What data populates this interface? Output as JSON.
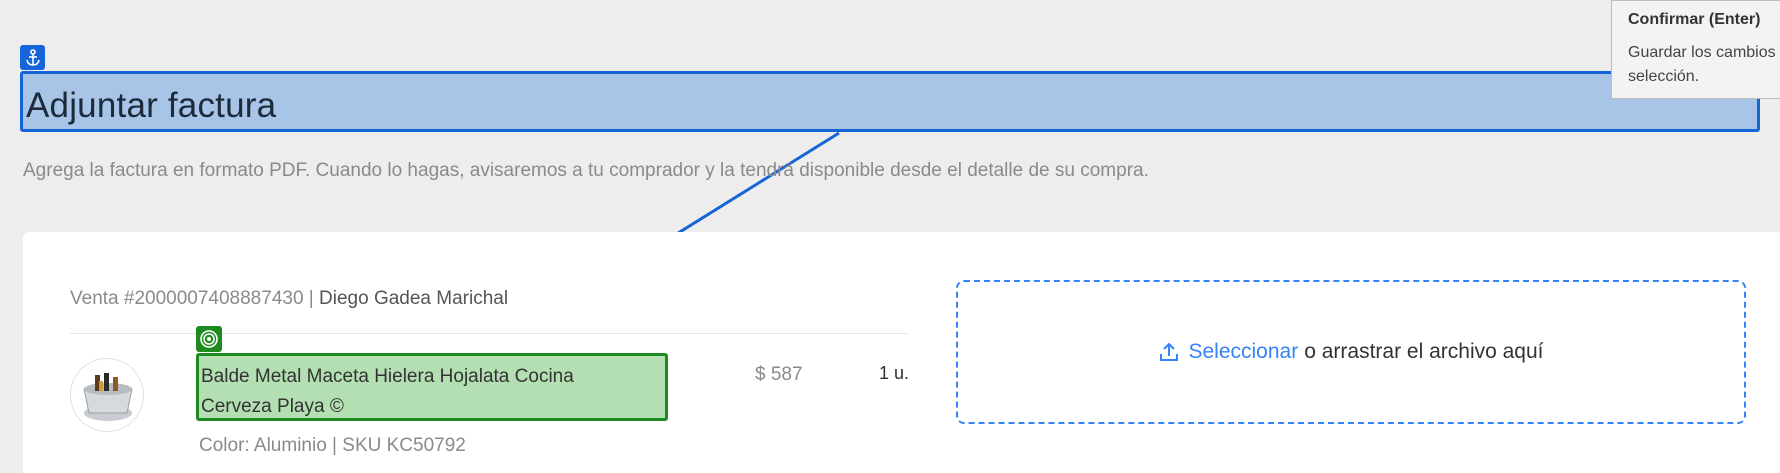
{
  "header": {
    "title": "Adjuntar factura",
    "subtitle": "Agrega la factura en formato PDF. Cuando lo hagas, avisaremos a tu comprador y la tendrá disponible desde el detalle de su compra."
  },
  "tooltip": {
    "title": "Confirmar (Enter)",
    "body": "Guardar los cambios selección."
  },
  "sale": {
    "number": "Venta #2000007408887430",
    "separator": " | ",
    "buyer": "Diego Gadea Marichal"
  },
  "product": {
    "name_line1": "Balde Metal Maceta Hielera Hojalata Cocina",
    "name_line2": "Cerveza Playa ©",
    "price": "$ 587",
    "quantity": "1 u.",
    "variant": "Color: Aluminio | SKU KC50792"
  },
  "upload": {
    "select_label": "Seleccionar",
    "hint": "o arrastrar el archivo aquí"
  },
  "icons": {
    "anchor": "anchor-icon",
    "target": "target-icon",
    "upload": "upload-icon"
  },
  "colors": {
    "accent": "#3483fa",
    "highlight_blue": "#1565d8",
    "highlight_green": "#1f8a1f"
  }
}
